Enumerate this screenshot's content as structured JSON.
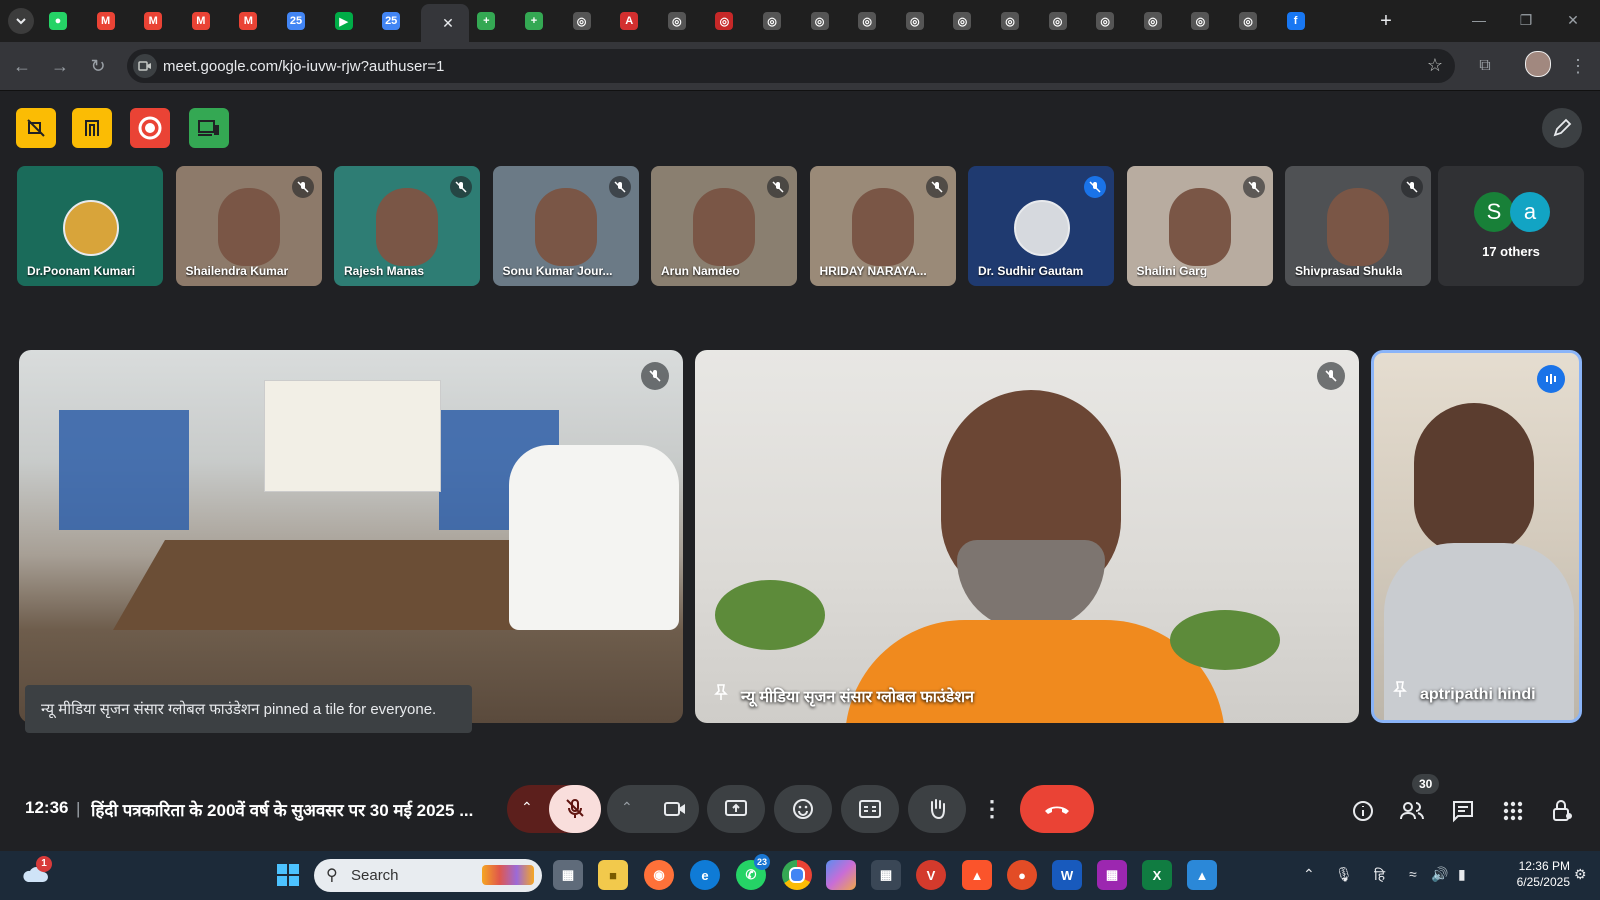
{
  "browser": {
    "url": "meet.google.com/kjo-iuvw-rjw?authuser=1",
    "tabs": [
      {
        "icon": "whatsapp-tab-icon",
        "color": "#25d366",
        "glyph": "●"
      },
      {
        "icon": "gmail-tab-icon",
        "color": "#ea4335",
        "glyph": "M"
      },
      {
        "icon": "gmail-tab-icon",
        "color": "#ea4335",
        "glyph": "M"
      },
      {
        "icon": "gmail-tab-icon",
        "color": "#ea4335",
        "glyph": "M"
      },
      {
        "icon": "gmail-tab-icon",
        "color": "#ea4335",
        "glyph": "M"
      },
      {
        "icon": "calendar-tab-icon",
        "color": "#4285f4",
        "glyph": "25"
      },
      {
        "icon": "meet-tab-icon",
        "color": "#00ac47",
        "glyph": "▶"
      },
      {
        "icon": "calendar-tab-icon",
        "color": "#4285f4",
        "glyph": "25"
      },
      {
        "icon": "forms-tab-icon",
        "color": "#7248b9",
        "glyph": "≡"
      },
      {
        "icon": "add-tab-icon",
        "color": "#34a853",
        "glyph": "+"
      },
      {
        "icon": "add-tab-icon",
        "color": "#34a853",
        "glyph": "+"
      },
      {
        "icon": "openai-tab-icon",
        "color": "#555",
        "glyph": "◎"
      },
      {
        "icon": "pdf-tab-icon",
        "color": "#d32f2f",
        "glyph": "A"
      },
      {
        "icon": "openai-tab-icon",
        "color": "#555",
        "glyph": "◎"
      },
      {
        "icon": "openai-tab-icon",
        "color": "#c62828",
        "glyph": "◎"
      },
      {
        "icon": "openai-tab-icon",
        "color": "#555",
        "glyph": "◎"
      },
      {
        "icon": "openai-tab-icon",
        "color": "#555",
        "glyph": "◎"
      },
      {
        "icon": "openai-tab-icon",
        "color": "#555",
        "glyph": "◎"
      },
      {
        "icon": "openai-tab-icon",
        "color": "#555",
        "glyph": "◎"
      },
      {
        "icon": "openai-tab-icon",
        "color": "#555",
        "glyph": "◎"
      },
      {
        "icon": "openai-tab-icon",
        "color": "#555",
        "glyph": "◎"
      },
      {
        "icon": "openai-tab-icon",
        "color": "#555",
        "glyph": "◎"
      },
      {
        "icon": "openai-tab-icon",
        "color": "#555",
        "glyph": "◎"
      },
      {
        "icon": "openai-tab-icon",
        "color": "#555",
        "glyph": "◎"
      },
      {
        "icon": "openai-tab-icon",
        "color": "#555",
        "glyph": "◎"
      },
      {
        "icon": "openai-tab-icon",
        "color": "#555",
        "glyph": "◎"
      },
      {
        "icon": "facebook-tab-icon",
        "color": "#1877f2",
        "glyph": "f"
      }
    ]
  },
  "thumbnails": [
    {
      "name": "Dr.Poonam Kumari",
      "bg": "#1a6b5a"
    },
    {
      "name": "Shailendra Kumar",
      "bg": "#8d7a6a"
    },
    {
      "name": "Rajesh Manas",
      "bg": "#2e7d74"
    },
    {
      "name": "Sonu Kumar Jour...",
      "bg": "#6b7a86"
    },
    {
      "name": "Arun Namdeo",
      "bg": "#8a7f70"
    },
    {
      "name": "HRIDAY NARAYA...",
      "bg": "#9a8a78"
    },
    {
      "name": "Dr. Sudhir Gautam",
      "bg": "#1f3a70"
    },
    {
      "name": "Shalini Garg",
      "bg": "#b8aca0"
    },
    {
      "name": "Shivprasad Shukla",
      "bg": "#4f5154"
    }
  ],
  "others": {
    "label": "17 others",
    "a1": "S",
    "a2": "a",
    "a1color": "#188038",
    "a2color": "#12a4c4"
  },
  "tiles": {
    "left_name": "",
    "center_name": "न्यू मीडिया सृजन संसार ग्लोबल फाउंडेशन",
    "right_name": "aptripathi hindi"
  },
  "toast": "न्यू मीडिया सृजन संसार ग्लोबल फाउंडेशन pinned a tile for everyone.",
  "bottom": {
    "time": "12:36",
    "separator": "|",
    "title": "हिंदी पत्रकारिता के 200वें वर्ष के सुअवसर पर 30 मई 2025 ...",
    "people_count": "30"
  },
  "taskbar": {
    "search_placeholder": "Search",
    "weather_badge": "1",
    "whatsapp_badge": "23",
    "time": "12:36 PM",
    "date": "6/25/2025",
    "lang": "हि"
  }
}
